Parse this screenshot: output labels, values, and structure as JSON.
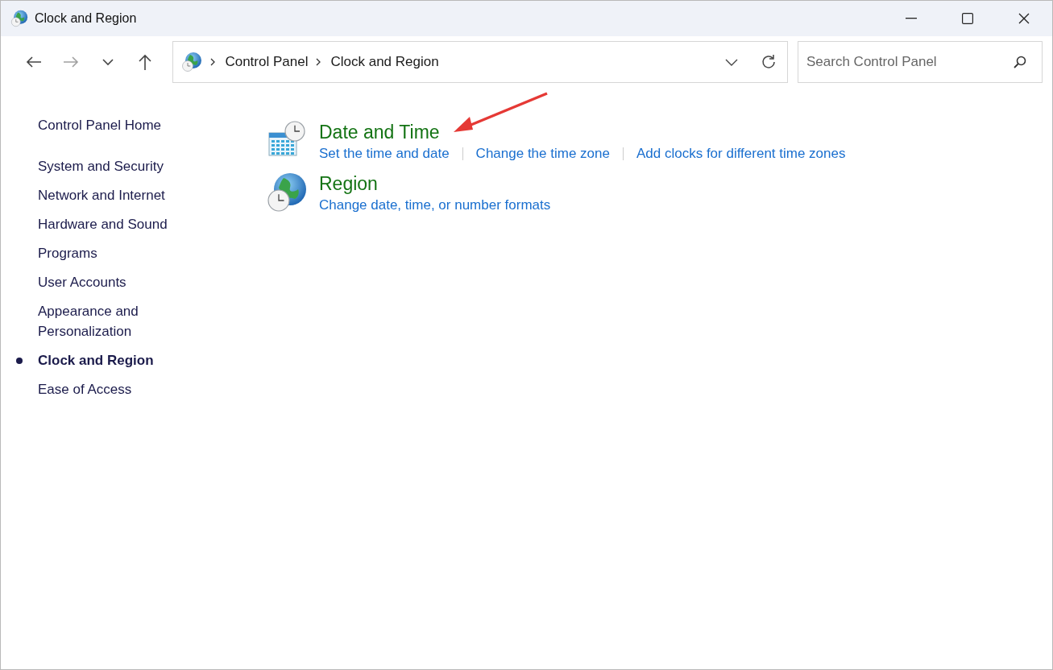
{
  "window": {
    "title": "Clock and Region"
  },
  "navigation": {
    "back": {
      "disabled": false
    },
    "forward": {
      "disabled": true
    }
  },
  "address_bar": {
    "path": [
      "Control Panel",
      "Clock and Region"
    ]
  },
  "search": {
    "placeholder": "Search Control Panel"
  },
  "sidebar": {
    "home": "Control Panel Home",
    "items": [
      {
        "label": "System and Security",
        "selected": false
      },
      {
        "label": "Network and Internet",
        "selected": false
      },
      {
        "label": "Hardware and Sound",
        "selected": false
      },
      {
        "label": "Programs",
        "selected": false
      },
      {
        "label": "User Accounts",
        "selected": false
      },
      {
        "label": "Appearance and Personalization",
        "selected": false
      },
      {
        "label": "Clock and Region",
        "selected": true
      },
      {
        "label": "Ease of Access",
        "selected": false
      }
    ]
  },
  "categories": [
    {
      "kind": "date-time",
      "title": "Date and Time",
      "links": [
        "Set the time and date",
        "Change the time zone",
        "Add clocks for different time zones"
      ]
    },
    {
      "kind": "region",
      "title": "Region",
      "links": [
        "Change date, time, or number formats"
      ]
    }
  ]
}
